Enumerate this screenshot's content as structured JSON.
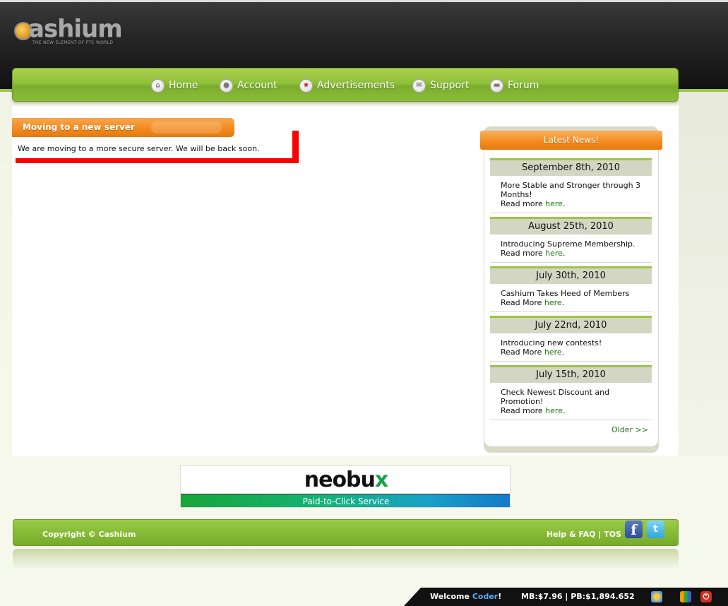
{
  "brand": {
    "logo_text": "ashium",
    "tagline": "THE NEW ELEMENT OF PTC WORLD"
  },
  "nav": {
    "items": [
      {
        "label": "Home",
        "icon": "home-icon"
      },
      {
        "label": "Account",
        "icon": "user-icon"
      },
      {
        "label": "Advertisements",
        "icon": "star-icon"
      },
      {
        "label": "Support",
        "icon": "mail-icon"
      },
      {
        "label": "Forum",
        "icon": "chat-icon"
      }
    ]
  },
  "notice": {
    "title": "Moving to a new server",
    "text": "We are moving to a more secure server. We will be back soon."
  },
  "news": {
    "header": "Latest News!",
    "items": [
      {
        "date": "September 8th, 2010",
        "text": "More Stable and Stronger through 3 Months!",
        "read_prefix": "Read more ",
        "link": "here",
        "suffix": "."
      },
      {
        "date": "August 25th, 2010",
        "text": "Introducing Supreme Membership.",
        "read_prefix": "Read more ",
        "link": "here",
        "suffix": "."
      },
      {
        "date": "July 30th, 2010",
        "text": "Cashium Takes Heed of Members",
        "read_prefix": "Read More ",
        "link": "here",
        "suffix": "."
      },
      {
        "date": "July 22nd, 2010",
        "text": "Introducing new contests!",
        "read_prefix": "Read More ",
        "link": "here",
        "suffix": "."
      },
      {
        "date": "July 15th, 2010",
        "text": "Check Newest Discount and Promotion!",
        "read_prefix": "Read more ",
        "link": "here",
        "suffix": "."
      }
    ],
    "older_label": "Older >>"
  },
  "banner": {
    "logo_main": "neobu",
    "logo_x": "x",
    "strip": "Paid-to-Click Service"
  },
  "footer": {
    "copyright": "Copyright © Cashium",
    "help_label": "Help & FAQ",
    "separator": " | ",
    "tos_label": "TOS",
    "facebook_glyph": "f",
    "twitter_glyph": "t"
  },
  "status": {
    "welcome_prefix": "Welcome ",
    "username": "Coder",
    "welcome_suffix": "!",
    "balances": "MB:$7.96 | PB:$1,894.652"
  },
  "colors": {
    "nav_green": "#8fc03a",
    "orange": "#f28b1f",
    "link_green": "#1f7a11",
    "red_mark": "#ff0000"
  }
}
